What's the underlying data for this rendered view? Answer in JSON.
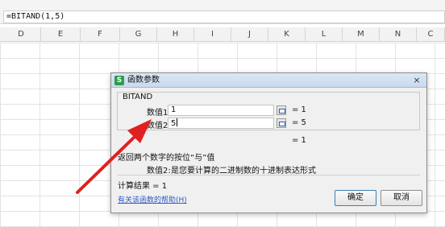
{
  "formula_bar": {
    "formula": "=BITAND(1,5)"
  },
  "columns": [
    "D",
    "E",
    "F",
    "G",
    "H",
    "I",
    "J",
    "K",
    "L",
    "M",
    "N",
    "C"
  ],
  "dialog": {
    "title": "函数参数",
    "app_icon": "S",
    "close_glyph": "×",
    "function_name": "BITAND",
    "args": [
      {
        "label": "数值1",
        "value": "1",
        "result": "= 1"
      },
      {
        "label": "数值2",
        "value": "5",
        "result": "= 5"
      }
    ],
    "formula_result": "= 1",
    "description": "返回两个数字的按位“与”值",
    "param_name": "数值2:",
    "param_desc": "是您要计算的二进制数的十进制表达形式",
    "calc_result": "计算结果 = 1",
    "help_link": "有关该函数的帮助(H)",
    "ok_label": "确定",
    "cancel_label": "取消"
  },
  "colors": {
    "annotation_arrow": "#e02020",
    "link": "#2d5cc7",
    "titlebar": "#c9d9ee"
  },
  "icons": {
    "close": "close-icon",
    "ref": "range-select-icon",
    "app": "wps-spreadsheet-icon"
  }
}
